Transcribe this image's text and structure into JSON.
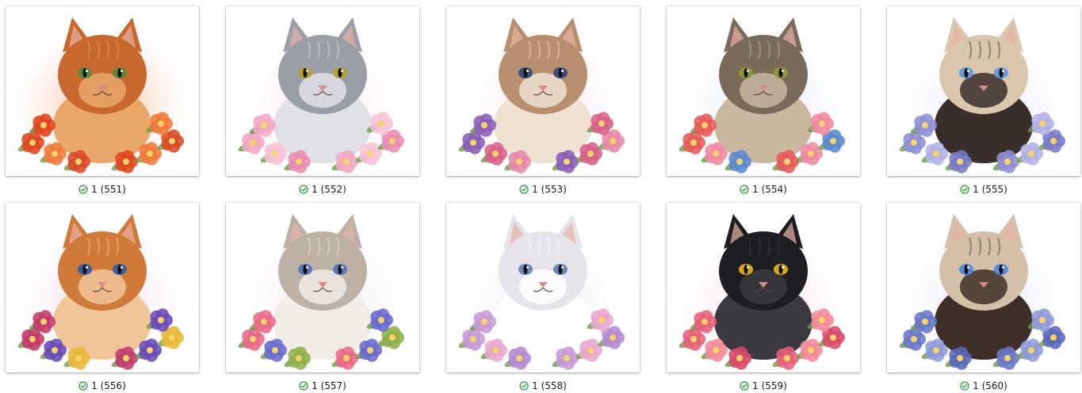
{
  "status_icon": "sync-check-icon",
  "status_color": "#2e9d3e",
  "files": [
    {
      "name": "1 (551)",
      "subject": "orange-tabby-cat",
      "fur": "#c8682e",
      "fur2": "#e9a86a",
      "eyes": "#5c8a3a",
      "flowers": [
        "#e0451f",
        "#f07a3a",
        "#d94a2a"
      ],
      "wash": "#f2b089"
    },
    {
      "name": "1 (552)",
      "subject": "silver-tabby-cat",
      "fur": "#9a9ea6",
      "fur2": "#dfe1e6",
      "eyes": "#b5a13a",
      "flowers": [
        "#f2a8c4",
        "#f7c2d6",
        "#e98db0"
      ],
      "wash": "#fbe3ec"
    },
    {
      "name": "1 (553)",
      "subject": "cream-tabby-cat",
      "fur": "#b78f6e",
      "fur2": "#efe2d2",
      "eyes": "#3e4f7c",
      "flowers": [
        "#8a5fb8",
        "#d8608a",
        "#e68aa8"
      ],
      "wash": "#f3e4f1"
    },
    {
      "name": "1 (554)",
      "subject": "brown-tabby-cat",
      "fur": "#7a6a5a",
      "fur2": "#c9b7a0",
      "eyes": "#8c9a3a",
      "flowers": [
        "#e85a5a",
        "#f08aa2",
        "#5a8ad0"
      ],
      "wash": "#dce9f7"
    },
    {
      "name": "1 (555)",
      "subject": "siamese-cat",
      "fur": "#d9c6ad",
      "fur2": "#3a2e2a",
      "eyes": "#6a9ad8",
      "flowers": [
        "#8f8fd6",
        "#b3b3e8",
        "#7a7ac8"
      ],
      "wash": "#e6e8f7"
    },
    {
      "name": "1 (556)",
      "subject": "orange-tabby-cat",
      "fur": "#d07a3a",
      "fur2": "#f1c59a",
      "eyes": "#3e5f9c",
      "flowers": [
        "#c23a6a",
        "#6a4ab8",
        "#e8b83a"
      ],
      "wash": "#f0d2e6"
    },
    {
      "name": "1 (557)",
      "subject": "ragdoll-cat",
      "fur": "#bdb0a4",
      "fur2": "#f2ece6",
      "eyes": "#5a78b8",
      "flowers": [
        "#e96a8a",
        "#6a6ad0",
        "#8fb04a"
      ],
      "wash": "#ede4ea"
    },
    {
      "name": "1 (558)",
      "subject": "white-persian-cat",
      "fur": "#e6e3ea",
      "fur2": "#ffffff",
      "eyes": "#6a88b8",
      "flowers": [
        "#c89ad6",
        "#e8a8d0",
        "#b48ad0"
      ],
      "wash": "#eee8f4"
    },
    {
      "name": "1 (559)",
      "subject": "black-cat",
      "fur": "#1e1e22",
      "fur2": "#3a3a40",
      "eyes": "#d8a81e",
      "flowers": [
        "#e8607a",
        "#f38a9a",
        "#d94a6a"
      ],
      "wash": "#f6dde2"
    },
    {
      "name": "1 (560)",
      "subject": "siamese-cat",
      "fur": "#d4c0a8",
      "fur2": "#3e2f28",
      "eyes": "#5a8ae0",
      "flowers": [
        "#6a78c8",
        "#8f9ad8",
        "#5a68b8"
      ],
      "wash": "#e2e6f4"
    }
  ]
}
